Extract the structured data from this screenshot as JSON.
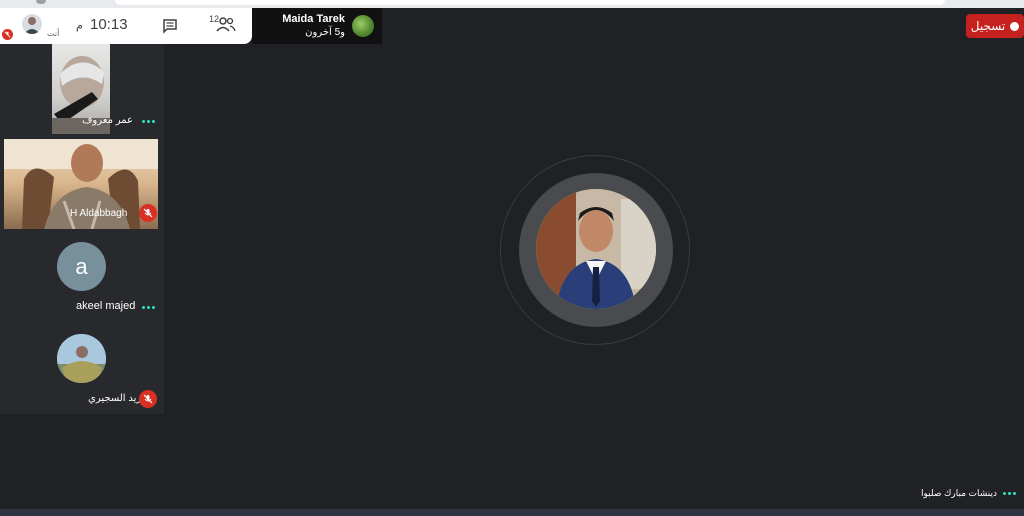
{
  "top_bar": {
    "self_label": "أنت",
    "time": "10:13",
    "time_suffix": "م",
    "people_count": "12",
    "icons": [
      "chat-icon",
      "people-icon",
      "mic-off-icon"
    ]
  },
  "presenter": {
    "name": "Maida Tarek",
    "others": "و5 آخرون"
  },
  "record": {
    "label": "تسجيل"
  },
  "participants": [
    {
      "name": "عمر معروف",
      "muted": false,
      "kind": "video"
    },
    {
      "name": "H Aldabbagh",
      "muted": true,
      "kind": "video"
    },
    {
      "name": "akeel majed",
      "muted": false,
      "kind": "letter",
      "initial": "a"
    },
    {
      "name": "زيد السجيري",
      "muted": true,
      "kind": "photo"
    }
  ],
  "status_bar": {
    "text": "دينشات مبارك صلبوا"
  },
  "colors": {
    "background": "#202124",
    "tile_background": "#28292c",
    "record_red": "#c5221f",
    "mute_red": "#d93025",
    "dots_teal": "#2de0c0"
  }
}
